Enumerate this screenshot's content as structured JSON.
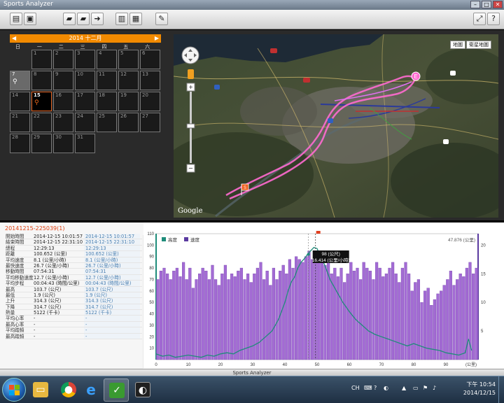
{
  "window": {
    "title": "Sports Analyzer"
  },
  "calendar": {
    "month_label": "2014 十二月",
    "weekdays": [
      "日",
      "一",
      "二",
      "三",
      "四",
      "五",
      "六"
    ],
    "days": [
      {
        "n": "1"
      },
      {
        "n": "2"
      },
      {
        "n": "3"
      },
      {
        "n": "4"
      },
      {
        "n": "5"
      },
      {
        "n": "6"
      },
      {
        "n": "7",
        "activity": true
      },
      {
        "n": "8"
      },
      {
        "n": "9"
      },
      {
        "n": "10"
      },
      {
        "n": "11"
      },
      {
        "n": "12"
      },
      {
        "n": "13"
      },
      {
        "n": "14"
      },
      {
        "n": "15",
        "activity": true,
        "today": true
      },
      {
        "n": "16"
      },
      {
        "n": "17"
      },
      {
        "n": "18"
      },
      {
        "n": "19"
      },
      {
        "n": "20"
      },
      {
        "n": "21"
      },
      {
        "n": "22"
      },
      {
        "n": "23"
      },
      {
        "n": "24"
      },
      {
        "n": "25"
      },
      {
        "n": "26"
      },
      {
        "n": "27"
      },
      {
        "n": "28"
      },
      {
        "n": "29"
      },
      {
        "n": "30"
      },
      {
        "n": "31"
      }
    ],
    "first_weekday": 1
  },
  "map": {
    "type_buttons": [
      "地圖",
      "衛星地圖"
    ],
    "attribution": "Google",
    "start_label": "S",
    "end_label": "E"
  },
  "stats": {
    "session": "20141215-225039(1)",
    "rows": [
      {
        "k": "開始時間",
        "v1": "2014-12-15 10:01:57",
        "v2": "2014-12-15 10:01:57"
      },
      {
        "k": "結束時間",
        "v1": "2014-12-15 22:31:10",
        "v2": "2014-12-15 22:31:10"
      },
      {
        "k": "總程",
        "v1": "12:29:13",
        "v2": "12:29:13"
      },
      {
        "k": "距離",
        "v1": "100.652 (公里)",
        "v2": "100.652 (公里)"
      },
      {
        "k": "平均速度",
        "v1": "8.1 (公里/小時)",
        "v2": "8.1 (公里/小時)"
      },
      {
        "k": "最快速度",
        "v1": "26.7 (公里/小時)",
        "v2": "26.7 (公里/小時)"
      },
      {
        "k": "移動時間",
        "v1": "07:54:31",
        "v2": "07:54:31"
      },
      {
        "k": "平均移動速度",
        "v1": "12.7 (公里/小時)",
        "v2": "12.7 (公里/小時)"
      },
      {
        "k": "平均步程",
        "v1": "00:04:43 (時間/公里)",
        "v2": "00:04:43 (時間/公里)"
      },
      {
        "k": "最高",
        "v1": "103.7 (公尺)",
        "v2": "103.7 (公尺)"
      },
      {
        "k": "最低",
        "v1": "1.9 (公尺)",
        "v2": "1.9 (公尺)"
      },
      {
        "k": "上升",
        "v1": "314.3 (公尺)",
        "v2": "314.3 (公尺)"
      },
      {
        "k": "下降",
        "v1": "314.7 (公尺)",
        "v2": "314.7 (公尺)"
      },
      {
        "k": "熱量",
        "v1": "5122 (千卡)",
        "v2": "5122 (千卡)"
      },
      {
        "k": "平均心率",
        "v1": "-",
        "v2": "-"
      },
      {
        "k": "最高心率",
        "v1": "-",
        "v2": "-"
      },
      {
        "k": "平均踏頻",
        "v1": "-",
        "v2": "-"
      },
      {
        "k": "最高踏頻",
        "v1": "-",
        "v2": "-"
      }
    ]
  },
  "chart_data": {
    "type": "bar",
    "legend": [
      "高度",
      "速度"
    ],
    "x_unit": "(公里)",
    "xlim": [
      0,
      100
    ],
    "x_ticks": [
      0,
      10,
      20,
      30,
      40,
      50,
      60,
      70,
      80,
      90
    ],
    "y_left_ticks": [
      10,
      20,
      30,
      40,
      50,
      60,
      70,
      80,
      90,
      100,
      110
    ],
    "y_left_lim": [
      0,
      110
    ],
    "y_right_ticks": [
      5,
      10,
      15,
      20
    ],
    "y_right_lim": [
      0,
      22
    ],
    "top_right_value": "47.876 (公里)",
    "cursor": {
      "x": 49.5,
      "elev_label": "98 (公尺)",
      "speed_label": "16.414 (公里/小時)"
    },
    "speed_series": {
      "name": "速度",
      "values": [
        14,
        15.5,
        16,
        15,
        14,
        15.5,
        16,
        14.5,
        17,
        14,
        16,
        12.5,
        14,
        15,
        16,
        15.5,
        14,
        16.5,
        14,
        13,
        15,
        16.5,
        14,
        15,
        14.5,
        15.5,
        16,
        14,
        15,
        13.5,
        15,
        16,
        17,
        14,
        15.5,
        13,
        16,
        14,
        15.5,
        16.5,
        15,
        17.5,
        16,
        18,
        17.5,
        17,
        18,
        19,
        17.5,
        18.5,
        17,
        18,
        16.5,
        17,
        15,
        16,
        14.5,
        16,
        13.5,
        15,
        17,
        15.5,
        16,
        14,
        17,
        16,
        15.5,
        14,
        17,
        16,
        14.5,
        15,
        16,
        17,
        15,
        13.5,
        16,
        17,
        15,
        12,
        13.5,
        14,
        10,
        12,
        12.5,
        9.5,
        10.5,
        11.5,
        12,
        13,
        14,
        15.5,
        13,
        14,
        15,
        14.5,
        16,
        17,
        15,
        16
      ]
    },
    "elevation_series": {
      "name": "高度",
      "x": [
        0,
        2,
        4,
        6,
        8,
        10,
        12,
        14,
        16,
        18,
        20,
        22,
        24,
        26,
        28,
        30,
        32,
        34,
        36,
        38,
        40,
        41,
        42,
        43,
        44,
        45,
        46,
        47,
        48,
        49,
        50,
        51,
        52,
        53,
        54,
        56,
        58,
        60,
        62,
        64,
        66,
        68,
        70,
        72,
        74,
        76,
        78,
        80,
        82,
        84,
        86,
        88,
        90,
        92,
        94,
        96,
        97,
        98
      ],
      "values": [
        5,
        3,
        4,
        2,
        3,
        4,
        3,
        2,
        4,
        3,
        5,
        6,
        5,
        8,
        10,
        12,
        15,
        20,
        25,
        35,
        50,
        60,
        68,
        72,
        80,
        85,
        88,
        92,
        95,
        98,
        97,
        90,
        85,
        78,
        70,
        60,
        50,
        42,
        35,
        30,
        25,
        22,
        20,
        18,
        16,
        14,
        12,
        14,
        12,
        10,
        9,
        8,
        6,
        5,
        4,
        6,
        18,
        8
      ]
    }
  },
  "appstrip": {
    "label": "Sports Analyzer"
  },
  "taskbar": {
    "lang": "CH",
    "time": "下午 10:54",
    "date": "2014/12/15"
  }
}
